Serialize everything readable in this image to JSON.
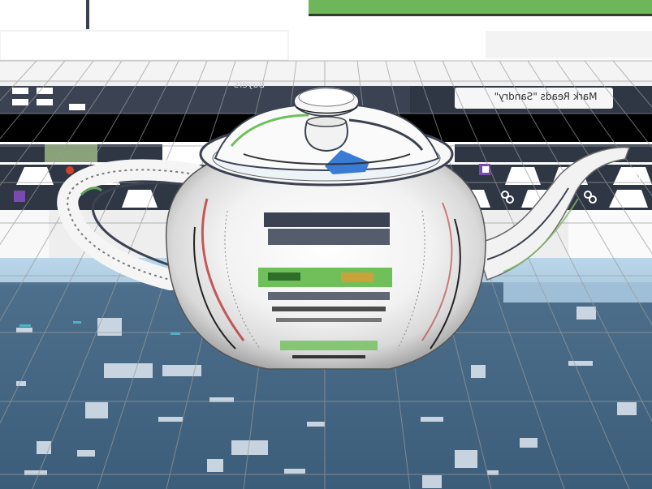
{
  "scene": {
    "view": "3d-viewport",
    "object": "teapot",
    "material": "chrome-reflective",
    "floor_grid": true
  },
  "reflected_ui": {
    "banner_text": "Mark Reads \"Sandry\"",
    "tab_label": "Buyers",
    "icons": [
      "link-icon",
      "link-icon",
      "link-icon",
      "calendar-icon",
      "calendar-icon",
      "flag-icon",
      "pin-icon"
    ]
  },
  "colors": {
    "floor": "#42627e",
    "floor_light": "#b9d6ea",
    "dark_band": "#3a3f4a",
    "black_band": "#000000",
    "green_image": "#6fbf5a",
    "accent_purple": "#7a4ab0",
    "accent_red": "#d0402a"
  }
}
